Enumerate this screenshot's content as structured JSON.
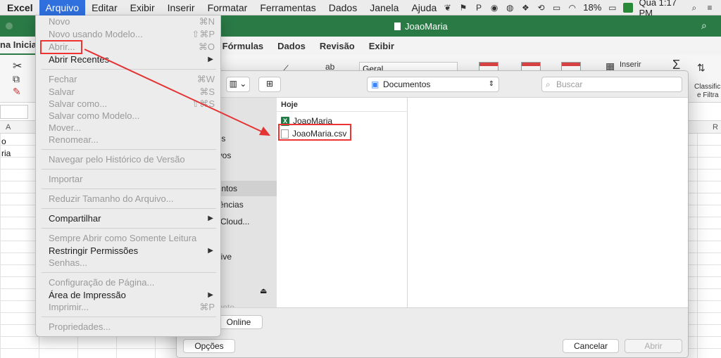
{
  "menubar": {
    "app": "Excel",
    "items": [
      "Arquivo",
      "Editar",
      "Exibir",
      "Inserir",
      "Formatar",
      "Ferramentas",
      "Dados",
      "Janela",
      "Ajuda"
    ],
    "battery": "18%",
    "clock": "Qua 1:17 PM"
  },
  "window": {
    "title": "JoaoMaria"
  },
  "ribbon": {
    "tabs": [
      "na Inicial",
      "Fórmulas",
      "Dados",
      "Revisão",
      "Exibir"
    ],
    "number_format": "Geral",
    "insert_label": "Inserir",
    "sort_label_1": "Classific",
    "sort_label_2": "e Filtra"
  },
  "sheet": {
    "col_a": "A",
    "col_r": "R",
    "cell_1": "o",
    "cell_2": "ria"
  },
  "file_menu": {
    "items": [
      {
        "label": "Novo",
        "shortcut": "⌘N"
      },
      {
        "label": "Novo usando Modelo...",
        "shortcut": "⇧⌘P"
      },
      {
        "label": "Abrir...",
        "shortcut": "⌘O"
      },
      {
        "label": "Abrir Recentes"
      },
      {
        "label": "Fechar",
        "shortcut": "⌘W"
      },
      {
        "label": "Salvar",
        "shortcut": "⌘S"
      },
      {
        "label": "Salvar como...",
        "shortcut": "⇧⌘S"
      },
      {
        "label": "Salvar como Modelo..."
      },
      {
        "label": "Mover..."
      },
      {
        "label": "Renomear..."
      },
      {
        "label": "Navegar pelo Histórico de Versão"
      },
      {
        "label": "Importar"
      },
      {
        "label": "Reduzir Tamanho do Arquivo..."
      },
      {
        "label": "Compartilhar"
      },
      {
        "label": "Sempre Abrir como Somente Leitura"
      },
      {
        "label": "Restringir Permissões"
      },
      {
        "label": "Senhas..."
      },
      {
        "label": "Configuração de Página..."
      },
      {
        "label": "Área de Impressão"
      },
      {
        "label": "Imprimir...",
        "shortcut": "⌘P"
      },
      {
        "label": "Propriedades..."
      }
    ]
  },
  "dialog": {
    "location": "Documentos",
    "search_placeholder": "Buscar",
    "sidebar": [
      "box",
      "entes",
      "cativos",
      "a",
      "umentos",
      "sferências",
      "tive Cloud...",
      "d Drive",
      "pad",
      "Remoto"
    ],
    "group_header": "Hoje",
    "files": [
      "JoaoMaria",
      "JoaoMaria.csv"
    ],
    "online_button": "Online",
    "options_button": "Opções",
    "cancel_button": "Cancelar",
    "open_button": "Abrir"
  },
  "colors": {
    "excel_green": "#2a7a46",
    "menu_active": "#2f6fde",
    "annotation": "#e33333"
  }
}
